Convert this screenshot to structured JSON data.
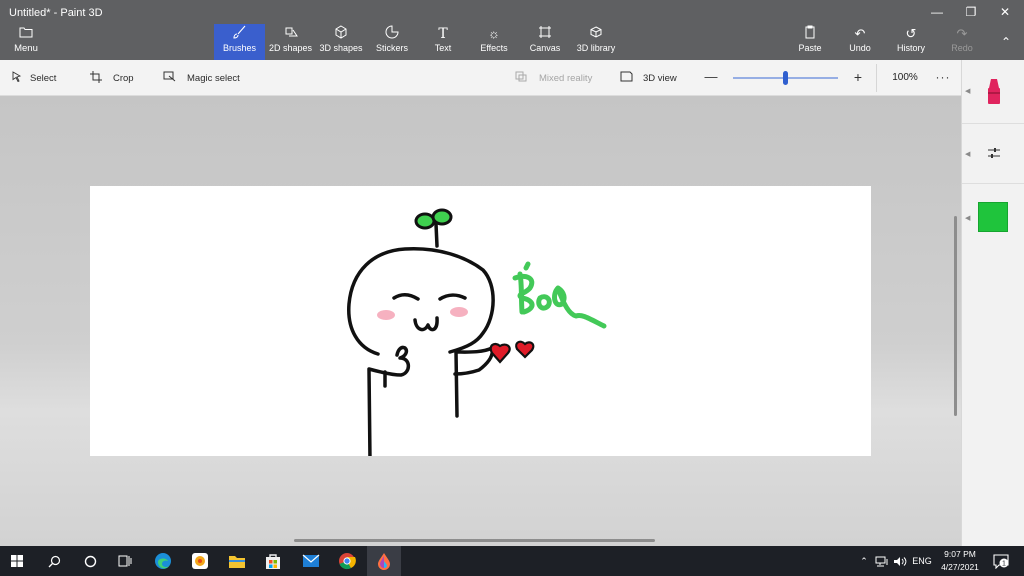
{
  "window": {
    "title": "Untitled* - Paint 3D"
  },
  "ribbon": {
    "menu_label": "Menu",
    "tools": [
      {
        "label": "Brushes",
        "icon": "brush-icon"
      },
      {
        "label": "2D shapes",
        "icon": "2d-shapes-icon"
      },
      {
        "label": "3D shapes",
        "icon": "3d-shapes-icon"
      },
      {
        "label": "Stickers",
        "icon": "stickers-icon"
      },
      {
        "label": "Text",
        "icon": "text-icon"
      },
      {
        "label": "Effects",
        "icon": "effects-icon"
      },
      {
        "label": "Canvas",
        "icon": "canvas-icon"
      },
      {
        "label": "3D library",
        "icon": "3d-library-icon"
      }
    ],
    "actions": [
      {
        "label": "Paste",
        "icon": "paste-icon"
      },
      {
        "label": "Undo",
        "icon": "undo-icon"
      },
      {
        "label": "History",
        "icon": "history-icon"
      },
      {
        "label": "Redo",
        "icon": "redo-icon"
      }
    ]
  },
  "toolbar": {
    "select_label": "Select",
    "crop_label": "Crop",
    "magic_select_label": "Magic select",
    "mixed_reality_label": "Mixed reality",
    "view_3d_label": "3D view",
    "zoom_value": "100%",
    "more_label": "···",
    "zoom_fraction": 0.5
  },
  "sidepanel": {
    "brush_color": "#e0245e",
    "selected_color": "#1fc43c"
  },
  "taskbar": {
    "apps": [
      "windows-start-icon",
      "search-icon",
      "cortana-icon",
      "task-view-icon",
      "edge-icon",
      "paint-icon",
      "file-explorer-icon",
      "store-icon",
      "mail-icon",
      "chrome-icon",
      "paint-3d-icon"
    ],
    "language": "ENG",
    "time": "9:07 PM",
    "date": "4/27/2021",
    "notification_count": "1"
  }
}
